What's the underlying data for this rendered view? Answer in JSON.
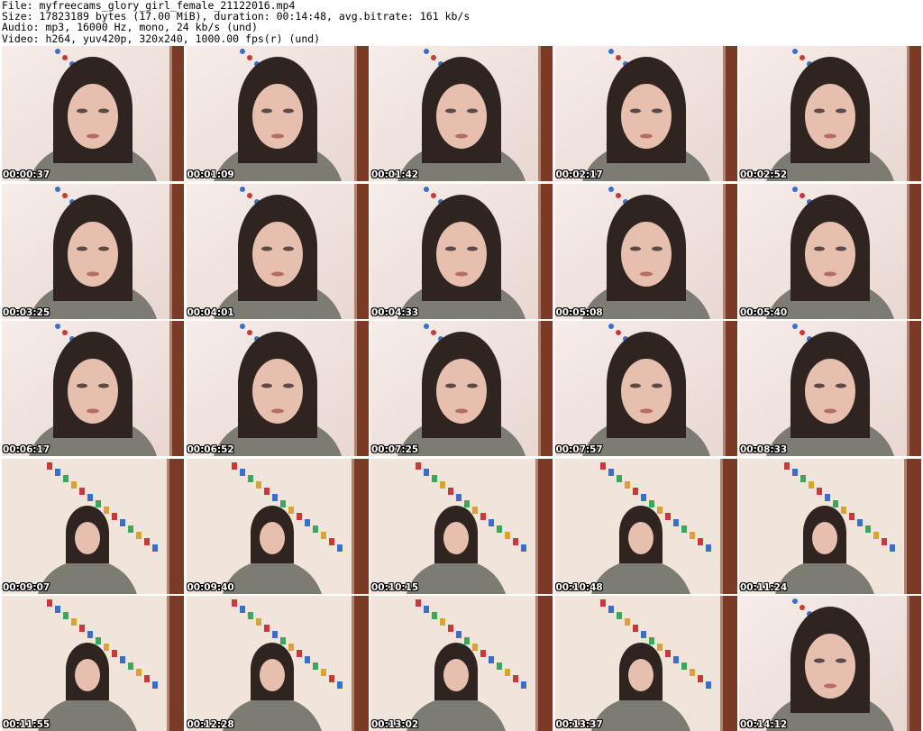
{
  "header": {
    "file": "File: myfreecams_glory_girl_female_21122016.mp4",
    "size": "Size: 17823189 bytes (17.00 MiB), duration: 00:14:48, avg.bitrate: 161 kb/s",
    "audio": "Audio: mp3, 16000 Hz, mono, 24 kb/s (und)",
    "video": "Video: h264, yuv420p, 320x240, 1000.00 fps(r) (und)"
  },
  "colors": {
    "wall": "#f3e6e2",
    "sweater": "#7d7c72",
    "hair": "#2f2420",
    "skin": "#e6bfae",
    "door": "#7a3a26",
    "garland": "#2e4a8f"
  },
  "frames": [
    {
      "time": "00:00:37",
      "shot": "close"
    },
    {
      "time": "00:01:09",
      "shot": "close"
    },
    {
      "time": "00:01:42",
      "shot": "close"
    },
    {
      "time": "00:02:17",
      "shot": "close"
    },
    {
      "time": "00:02:52",
      "shot": "close"
    },
    {
      "time": "00:03:25",
      "shot": "close"
    },
    {
      "time": "00:04:01",
      "shot": "close"
    },
    {
      "time": "00:04:33",
      "shot": "close"
    },
    {
      "time": "00:05:08",
      "shot": "close"
    },
    {
      "time": "00:05:40",
      "shot": "close"
    },
    {
      "time": "00:06:17",
      "shot": "close"
    },
    {
      "time": "00:06:52",
      "shot": "close"
    },
    {
      "time": "00:07:25",
      "shot": "close"
    },
    {
      "time": "00:07:57",
      "shot": "close"
    },
    {
      "time": "00:08:33",
      "shot": "close"
    },
    {
      "time": "00:09:07",
      "shot": "far"
    },
    {
      "time": "00:09:40",
      "shot": "far"
    },
    {
      "time": "00:10:15",
      "shot": "far"
    },
    {
      "time": "00:10:48",
      "shot": "far"
    },
    {
      "time": "00:11:24",
      "shot": "far"
    },
    {
      "time": "00:11:55",
      "shot": "far"
    },
    {
      "time": "00:12:28",
      "shot": "far"
    },
    {
      "time": "00:13:02",
      "shot": "far"
    },
    {
      "time": "00:13:37",
      "shot": "far"
    },
    {
      "time": "00:14:12",
      "shot": "close"
    }
  ]
}
